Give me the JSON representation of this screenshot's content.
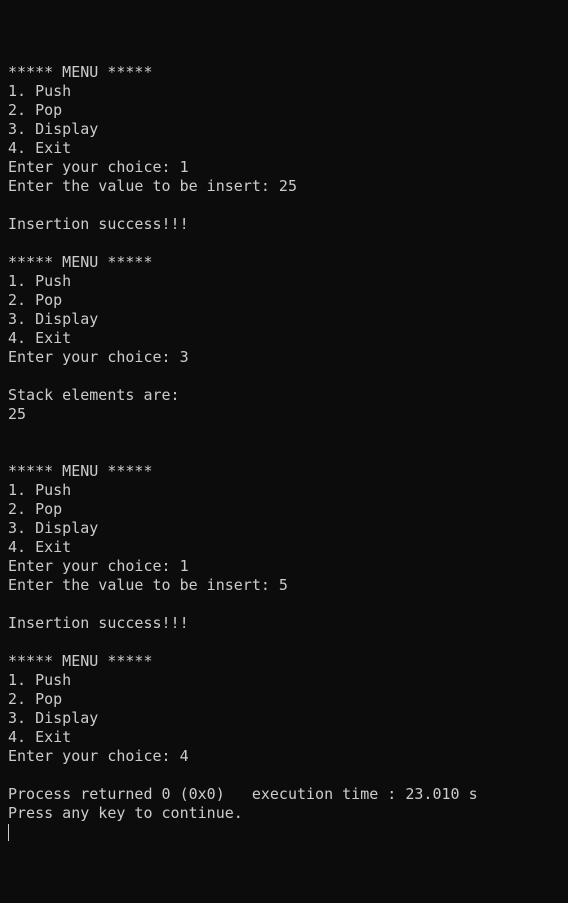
{
  "console": {
    "lines": [
      "",
      "***** MENU *****",
      "1. Push",
      "2. Pop",
      "3. Display",
      "4. Exit",
      "Enter your choice: 1",
      "Enter the value to be insert: 25",
      "",
      "Insertion success!!!",
      "",
      "***** MENU *****",
      "1. Push",
      "2. Pop",
      "3. Display",
      "4. Exit",
      "Enter your choice: 3",
      "",
      "Stack elements are:",
      "25",
      "",
      "",
      "***** MENU *****",
      "1. Push",
      "2. Pop",
      "3. Display",
      "4. Exit",
      "Enter your choice: 1",
      "Enter the value to be insert: 5",
      "",
      "Insertion success!!!",
      "",
      "***** MENU *****",
      "1. Push",
      "2. Pop",
      "3. Display",
      "4. Exit",
      "Enter your choice: 4",
      "",
      "Process returned 0 (0x0)   execution time : 23.010 s",
      "Press any key to continue."
    ]
  }
}
